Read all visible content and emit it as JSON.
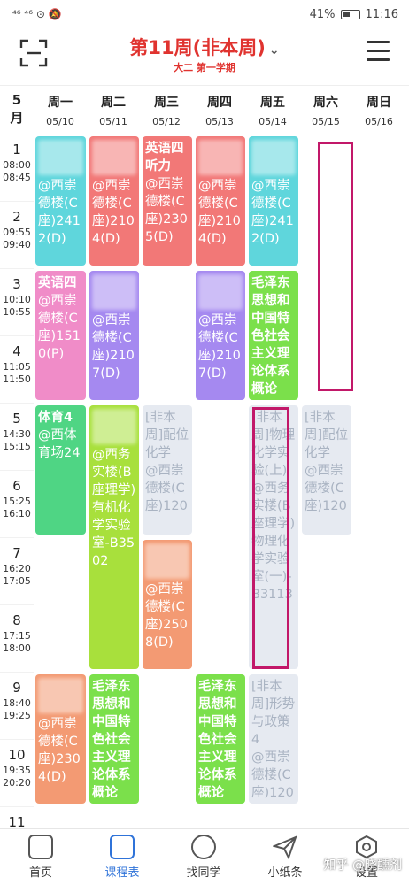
{
  "status": {
    "left": "⁴⁶ ⁴⁶ ⊙ 🔕",
    "battery": "41%",
    "time": "11:16"
  },
  "header": {
    "week": "第11周(非本周)",
    "term": "大二 第一学期"
  },
  "month": "5\n月",
  "days": [
    {
      "name": "周一",
      "date": "05/10"
    },
    {
      "name": "周二",
      "date": "05/11"
    },
    {
      "name": "周三",
      "date": "05/12"
    },
    {
      "name": "周四",
      "date": "05/13"
    },
    {
      "name": "周五",
      "date": "05/14"
    },
    {
      "name": "周六",
      "date": "05/15"
    },
    {
      "name": "周日",
      "date": "05/16"
    }
  ],
  "periods": [
    {
      "num": "1",
      "time": "08:00\n08:45"
    },
    {
      "num": "2",
      "time": "09:55\n09:40"
    },
    {
      "num": "3",
      "time": "10:10\n10:55"
    },
    {
      "num": "4",
      "time": "11:05\n11:50"
    },
    {
      "num": "5",
      "time": "14:30\n15:15"
    },
    {
      "num": "6",
      "time": "15:25\n16:10"
    },
    {
      "num": "7",
      "time": "16:20\n17:05"
    },
    {
      "num": "8",
      "time": "17:15\n18:00"
    },
    {
      "num": "9",
      "time": "18:40\n19:25"
    },
    {
      "num": "10",
      "time": "19:35\n20:20"
    },
    {
      "num": "11",
      "time": ""
    }
  ],
  "courses": [
    {
      "id": "mon-12",
      "name": "",
      "loc": "@西崇德楼(C座)2412(D)",
      "color": "#5fd6dc"
    },
    {
      "id": "tue-12",
      "name": "",
      "loc": "@西崇德楼(C座)2104(D)",
      "color": "#f27877"
    },
    {
      "id": "wed-12",
      "name": "英语四听力",
      "loc": "@西崇德楼(C座)2305(D)",
      "color": "#f27877"
    },
    {
      "id": "thu-12",
      "name": "",
      "loc": "@西崇德楼(C座)2104(D)",
      "color": "#f27877"
    },
    {
      "id": "fri-12",
      "name": "",
      "loc": "@西崇德楼(C座)2412(D)",
      "color": "#5fd6dc"
    },
    {
      "id": "mon-34",
      "name": "英语四",
      "loc": "@西崇德楼(C座)1510(P)",
      "color": "#f08cc8"
    },
    {
      "id": "tue-34",
      "name": "",
      "loc": "@西崇德楼(C座)2107(D)",
      "color": "#a589f0"
    },
    {
      "id": "thu-34",
      "name": "",
      "loc": "@西崇德楼(C座)2107(D)",
      "color": "#a589f0"
    },
    {
      "id": "fri-34",
      "name": "毛泽东思想和中国特色社会主义理论体系概论",
      "loc": "",
      "color": "#7be04b"
    },
    {
      "id": "mon-56",
      "name": "体育4",
      "loc": "@西体育场24",
      "color": "#4fd584"
    },
    {
      "id": "tue-58",
      "name": "",
      "loc": "@西务实楼(B座理学)有机化学实验室-B3502",
      "color": "#a8e03c"
    },
    {
      "id": "wed-56",
      "name": "[非本周]配位化学",
      "loc": "@西崇德楼(C座)120",
      "color": "ghost"
    },
    {
      "id": "fri-58",
      "name": "[非本周]物理化学实验(上)",
      "loc": "@西务实楼(B座理学)物理化学实验室(一)-B3113",
      "color": "ghost"
    },
    {
      "id": "sat-56",
      "name": "[非本周]配位化学",
      "loc": "@西崇德楼(C座)120",
      "color": "ghost"
    },
    {
      "id": "wed-78",
      "name": "",
      "loc": "@西崇德楼(C座)2508(D)",
      "color": "#f39a73"
    },
    {
      "id": "mon-910",
      "name": "",
      "loc": "@西崇德楼(C座)2304(D)",
      "color": "#f39a73"
    },
    {
      "id": "tue-910",
      "name": "毛泽东思想和中国特色社会主义理论体系概论",
      "loc": "",
      "color": "#7be04b"
    },
    {
      "id": "thu-910",
      "name": "毛泽东思想和中国特色社会主义理论体系概论",
      "loc": "",
      "color": "#7be04b"
    },
    {
      "id": "fri-910",
      "name": "[非本周]形势与政策4",
      "loc": "@西崇德楼(C座)120",
      "color": "ghost"
    }
  ],
  "tabs": [
    {
      "label": "首页",
      "icon": "home-face-icon"
    },
    {
      "label": "课程表",
      "icon": "schedule-icon"
    },
    {
      "label": "找同学",
      "icon": "classmates-icon"
    },
    {
      "label": "小纸条",
      "icon": "paper-plane-icon"
    },
    {
      "label": "设置",
      "icon": "settings-hex-icon"
    }
  ],
  "watermark": "知乎 @晓醺剂"
}
